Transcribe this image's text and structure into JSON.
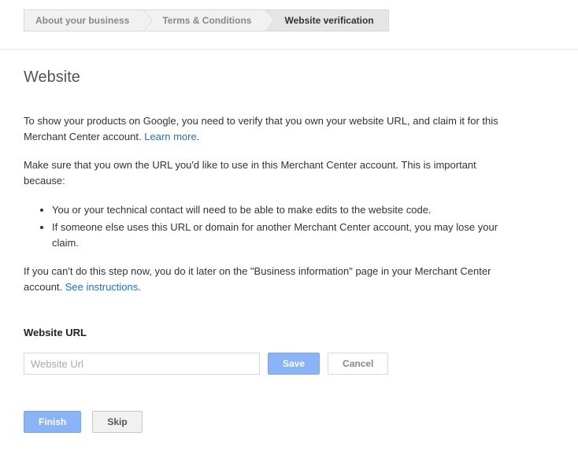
{
  "breadcrumb": {
    "step1": "About your business",
    "step2": "Terms & Conditions",
    "step3": "Website verification"
  },
  "title": "Website",
  "intro_part1": "To show your products on Google, you need to verify that you own your website URL, and claim it for this Merchant Center account. ",
  "learn_more": "Learn more",
  "period1": ".",
  "ownership_text": "Make sure that you own the URL you'd like to use in this Merchant Center account. This is important because:",
  "bullet1": "You or your technical contact will need to be able to make edits to the website code.",
  "bullet2": "If someone else uses this URL or domain for another Merchant Center account, you may lose your claim.",
  "later_part1": "If you can't do this step now, you do it later on the \"Business information\" page in your Merchant Center account. ",
  "see_instructions": "See instructions",
  "period2": ".",
  "url_section_label": "Website URL",
  "url_placeholder": "Website Url",
  "buttons": {
    "save": "Save",
    "cancel": "Cancel",
    "finish": "Finish",
    "skip": "Skip"
  }
}
